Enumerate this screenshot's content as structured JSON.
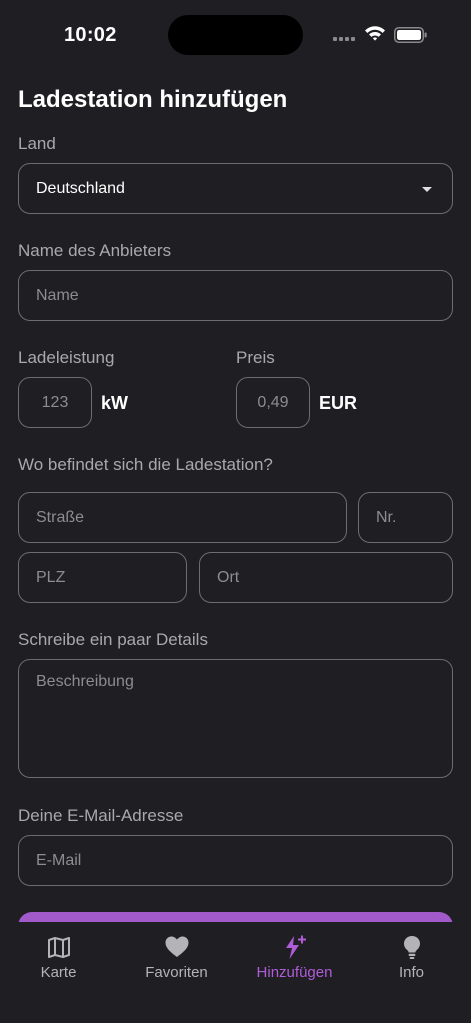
{
  "status_bar": {
    "time": "10:02"
  },
  "page": {
    "title": "Ladestation hinzufügen"
  },
  "country": {
    "label": "Land",
    "selected": "Deutschland"
  },
  "provider": {
    "label": "Name des Anbieters",
    "placeholder": "Name"
  },
  "power": {
    "label": "Ladeleistung",
    "placeholder": "123",
    "unit": "kW"
  },
  "price": {
    "label": "Preis",
    "placeholder": "0,49",
    "unit": "EUR"
  },
  "location": {
    "label": "Wo befindet sich die Ladestation?",
    "street_placeholder": "Straße",
    "number_placeholder": "Nr.",
    "zip_placeholder": "PLZ",
    "city_placeholder": "Ort"
  },
  "details": {
    "label": "Schreibe ein paar Details",
    "placeholder": "Beschreibung"
  },
  "email": {
    "label": "Deine E-Mail-Adresse",
    "placeholder": "E-Mail"
  },
  "tabs": [
    {
      "label": "Karte",
      "icon": "map-icon"
    },
    {
      "label": "Favoriten",
      "icon": "heart-icon"
    },
    {
      "label": "Hinzufügen",
      "icon": "bolt-plus-icon",
      "active": true
    },
    {
      "label": "Info",
      "icon": "lightbulb-icon"
    }
  ],
  "colors": {
    "accent": "#b05cd8",
    "background": "#1f1e23",
    "border": "#6d6c71"
  }
}
